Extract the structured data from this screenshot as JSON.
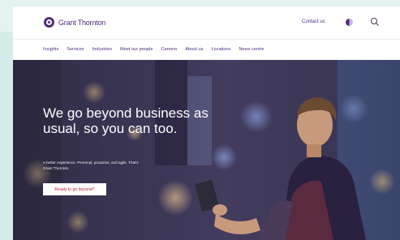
{
  "header": {
    "logo_text": "Grant Thornton",
    "contact_label": "Contact us",
    "language_icon": "globe-icon",
    "search_icon": "search-icon"
  },
  "nav": {
    "items": [
      "Insights",
      "Services",
      "Industries",
      "Meet our people",
      "Careers",
      "About us",
      "Locations",
      "News centre"
    ]
  },
  "hero": {
    "headline": "We go beyond business as usual, so you can too.",
    "subtext": "A better experience. Personal, proactive, and agile. That's Grant Thornton.",
    "cta_label": "Ready to go beyond?"
  },
  "colors": {
    "brand": "#4f2d7f",
    "cta_text": "#c41c3a",
    "page_bg": "#e4f3f1"
  }
}
